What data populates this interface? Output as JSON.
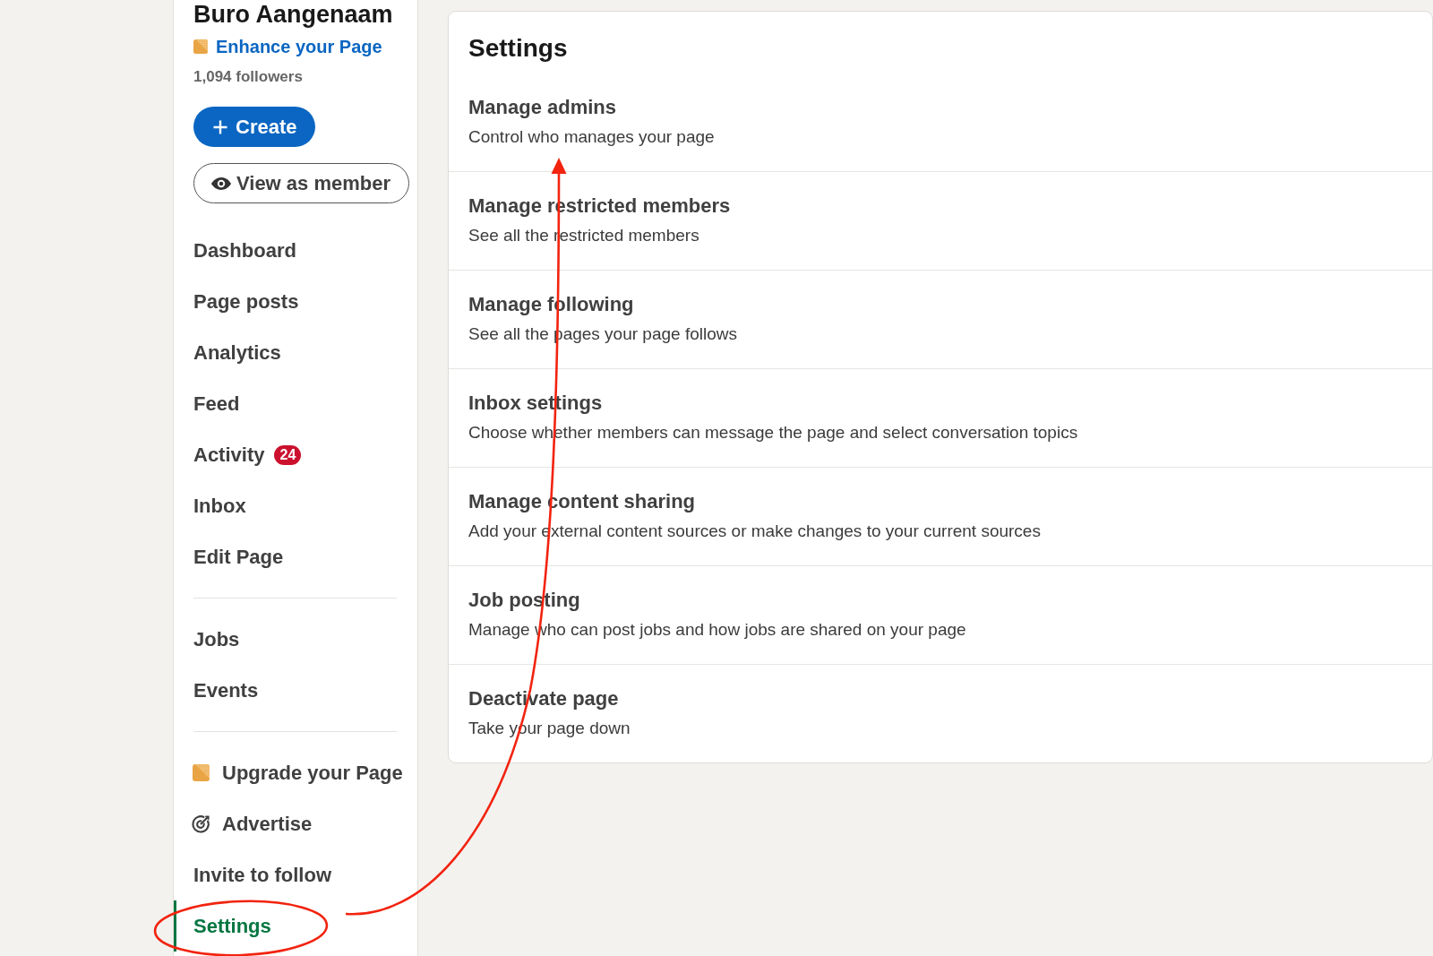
{
  "sidebar": {
    "page_name": "Buro Aangenaam",
    "enhance_link": "Enhance your Page",
    "followers": "1,094 followers",
    "create_button": "Create",
    "view_button": "View as member",
    "nav_groups": [
      {
        "items": [
          {
            "label": "Dashboard",
            "kind": "text",
            "selected": false
          },
          {
            "label": "Page posts",
            "kind": "text",
            "selected": false
          },
          {
            "label": "Analytics",
            "kind": "text",
            "selected": false
          },
          {
            "label": "Feed",
            "kind": "text",
            "selected": false
          },
          {
            "label": "Activity",
            "kind": "text",
            "badge": "24",
            "selected": false
          },
          {
            "label": "Inbox",
            "kind": "text",
            "selected": false
          },
          {
            "label": "Edit Page",
            "kind": "text",
            "selected": false
          }
        ]
      },
      {
        "items": [
          {
            "label": "Jobs",
            "kind": "text",
            "selected": false
          },
          {
            "label": "Events",
            "kind": "text",
            "selected": false
          }
        ]
      },
      {
        "items": [
          {
            "label": "Upgrade your Page",
            "kind": "premium",
            "selected": false
          },
          {
            "label": "Advertise",
            "kind": "ad",
            "selected": false
          },
          {
            "label": "Invite to follow",
            "kind": "text",
            "selected": false
          },
          {
            "label": "Settings",
            "kind": "text",
            "selected": true
          }
        ]
      }
    ]
  },
  "settings": {
    "title": "Settings",
    "rows": [
      {
        "title": "Manage admins",
        "description": "Control who manages your page"
      },
      {
        "title": "Manage restricted members",
        "description": "See all the restricted members"
      },
      {
        "title": "Manage following",
        "description": "See all the pages your page follows"
      },
      {
        "title": "Inbox settings",
        "description": "Choose whether members can message the page and select conversation topics"
      },
      {
        "title": "Manage content sharing",
        "description": "Add your external content sources or make changes to your current sources"
      },
      {
        "title": "Job posting",
        "description": "Manage who can post jobs and how jobs are shared on your page"
      },
      {
        "title": "Deactivate page",
        "description": "Take your page down"
      }
    ]
  }
}
